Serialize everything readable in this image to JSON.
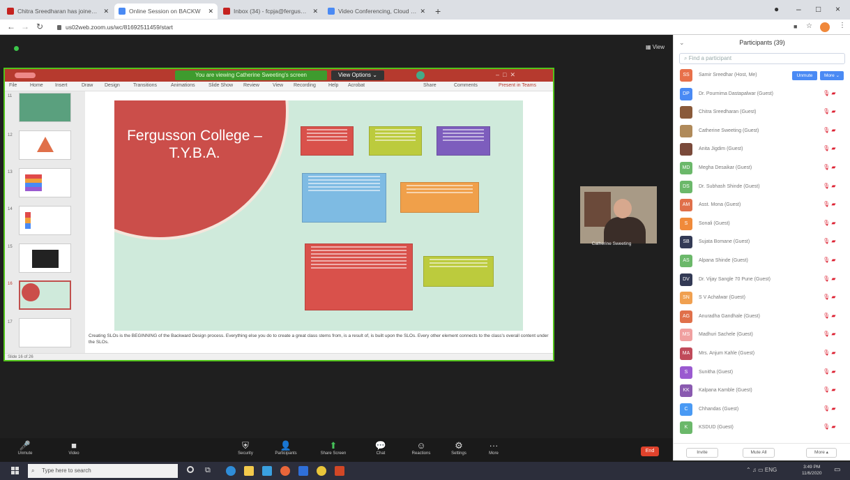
{
  "browser": {
    "tabs": [
      {
        "label": "Chitra Sreedharan has joined yo",
        "favicon_color": "#c5221f"
      },
      {
        "label": "Online Session on BACKW",
        "favicon_color": "#4a8af4",
        "active": true
      },
      {
        "label": "Inbox (34) - fcpja@fergusson.",
        "favicon_color": "#c5221f"
      },
      {
        "label": "Video Conferencing, Cloud Pho",
        "favicon_color": "#4a8af4"
      }
    ],
    "url": "us02web.zoom.us/wc/81692511459/start",
    "new_tab": "+",
    "minimize": "–",
    "maximize": "□",
    "close": "×"
  },
  "meeting": {
    "view_label": "View",
    "share_banner": "You are viewing Catherine Sweeting's screen",
    "view_options": "View Options ⌄",
    "speaker_name": "Catherine Sweeting",
    "controls": [
      {
        "label": "Unmute",
        "icon": "🎤"
      },
      {
        "label": "Video",
        "icon": "■"
      },
      {
        "label": "Security",
        "icon": "⛨"
      },
      {
        "label": "Participants",
        "icon": "👤"
      },
      {
        "label": "Share Screen",
        "icon": "⬆"
      },
      {
        "label": "Chat",
        "icon": "💬"
      },
      {
        "label": "Reactions",
        "icon": "☺"
      },
      {
        "label": "Settings",
        "icon": "⚙"
      },
      {
        "label": "More",
        "icon": "···"
      }
    ],
    "end_label": "End"
  },
  "presentation": {
    "menu": [
      "File",
      "Home",
      "Insert",
      "Draw",
      "Design",
      "Transitions",
      "Animations",
      "Slide Show",
      "Review",
      "View",
      "Recording",
      "Help",
      "Acrobat"
    ],
    "menu_right": [
      "Share",
      "Comments",
      "Present in Teams"
    ],
    "slide_numbers": [
      "11",
      "12",
      "13",
      "14",
      "15",
      "16",
      "17"
    ],
    "slide_title": "Fergusson College – T.Y.B.A.",
    "notes": "Creating SLOs is the BEGINNING of the Backward Design process. Everything else you do to create a great class stems from, is a result of, is built upon the SLOs. Every other element connects to the class's overall content under the SLOs.",
    "status": "Slide 16 of 26"
  },
  "participants": {
    "title": "Participants (39)",
    "search_placeholder": "Find a participant",
    "list": [
      {
        "initials": "SS",
        "name": "Samir Sreedhar (Host, Me)",
        "color": "#e8704a",
        "host": true
      },
      {
        "initials": "DP",
        "name": "Dr. Pournima Dastapalwar (Guest)",
        "color": "#4a8af4"
      },
      {
        "initials": "",
        "name": "Chitra Sreedharan (Guest)",
        "color": "#8a5a3a"
      },
      {
        "initials": "",
        "name": "Catherine Sweeting (Guest)",
        "color": "#b08a5a"
      },
      {
        "initials": "",
        "name": "Anita Jigdim (Guest)",
        "color": "#7a4a3a"
      },
      {
        "initials": "MD",
        "name": "Megha Desaikar (Guest)",
        "color": "#6bb86a"
      },
      {
        "initials": "DS",
        "name": "Dr. Subhash Shinde (Guest)",
        "color": "#6bb86a"
      },
      {
        "initials": "AM",
        "name": "Asst. Mona (Guest)",
        "color": "#e0704a"
      },
      {
        "initials": "S",
        "name": "Sonali (Guest)",
        "color": "#f08a3a"
      },
      {
        "initials": "SB",
        "name": "Sujata Bomane (Guest)",
        "color": "#333a55"
      },
      {
        "initials": "AS",
        "name": "Alpana Shinde (Guest)",
        "color": "#6bb86a"
      },
      {
        "initials": "DV",
        "name": "Dr. Vijay Sangle 70 Pune (Guest)",
        "color": "#333a55"
      },
      {
        "initials": "SN",
        "name": "S V Achalwar (Guest)",
        "color": "#f0a050"
      },
      {
        "initials": "AG",
        "name": "Anuradha Gandhale (Guest)",
        "color": "#e0704a"
      },
      {
        "initials": "MS",
        "name": "Madhuri Sachele (Guest)",
        "color": "#f0a0a0"
      },
      {
        "initials": "MA",
        "name": "Mrs. Anjum Kahle (Guest)",
        "color": "#c04a5a"
      },
      {
        "initials": "S",
        "name": "Sunitha (Guest)",
        "color": "#9a5ad0"
      },
      {
        "initials": "KK",
        "name": "Kalpana Kamble (Guest)",
        "color": "#8a5ab0"
      },
      {
        "initials": "C",
        "name": "Chhandas (Guest)",
        "color": "#4a9af4"
      },
      {
        "initials": "K",
        "name": "KSDUD (Guest)",
        "color": "#6bb86a"
      }
    ],
    "host_buttons": [
      "Unmute",
      "More ⌄"
    ],
    "footer": [
      "Invite",
      "Mute All",
      "More ▴"
    ]
  },
  "taskbar": {
    "search_placeholder": "Type here to search",
    "time": "3:49 PM",
    "date": "11/6/2020"
  }
}
